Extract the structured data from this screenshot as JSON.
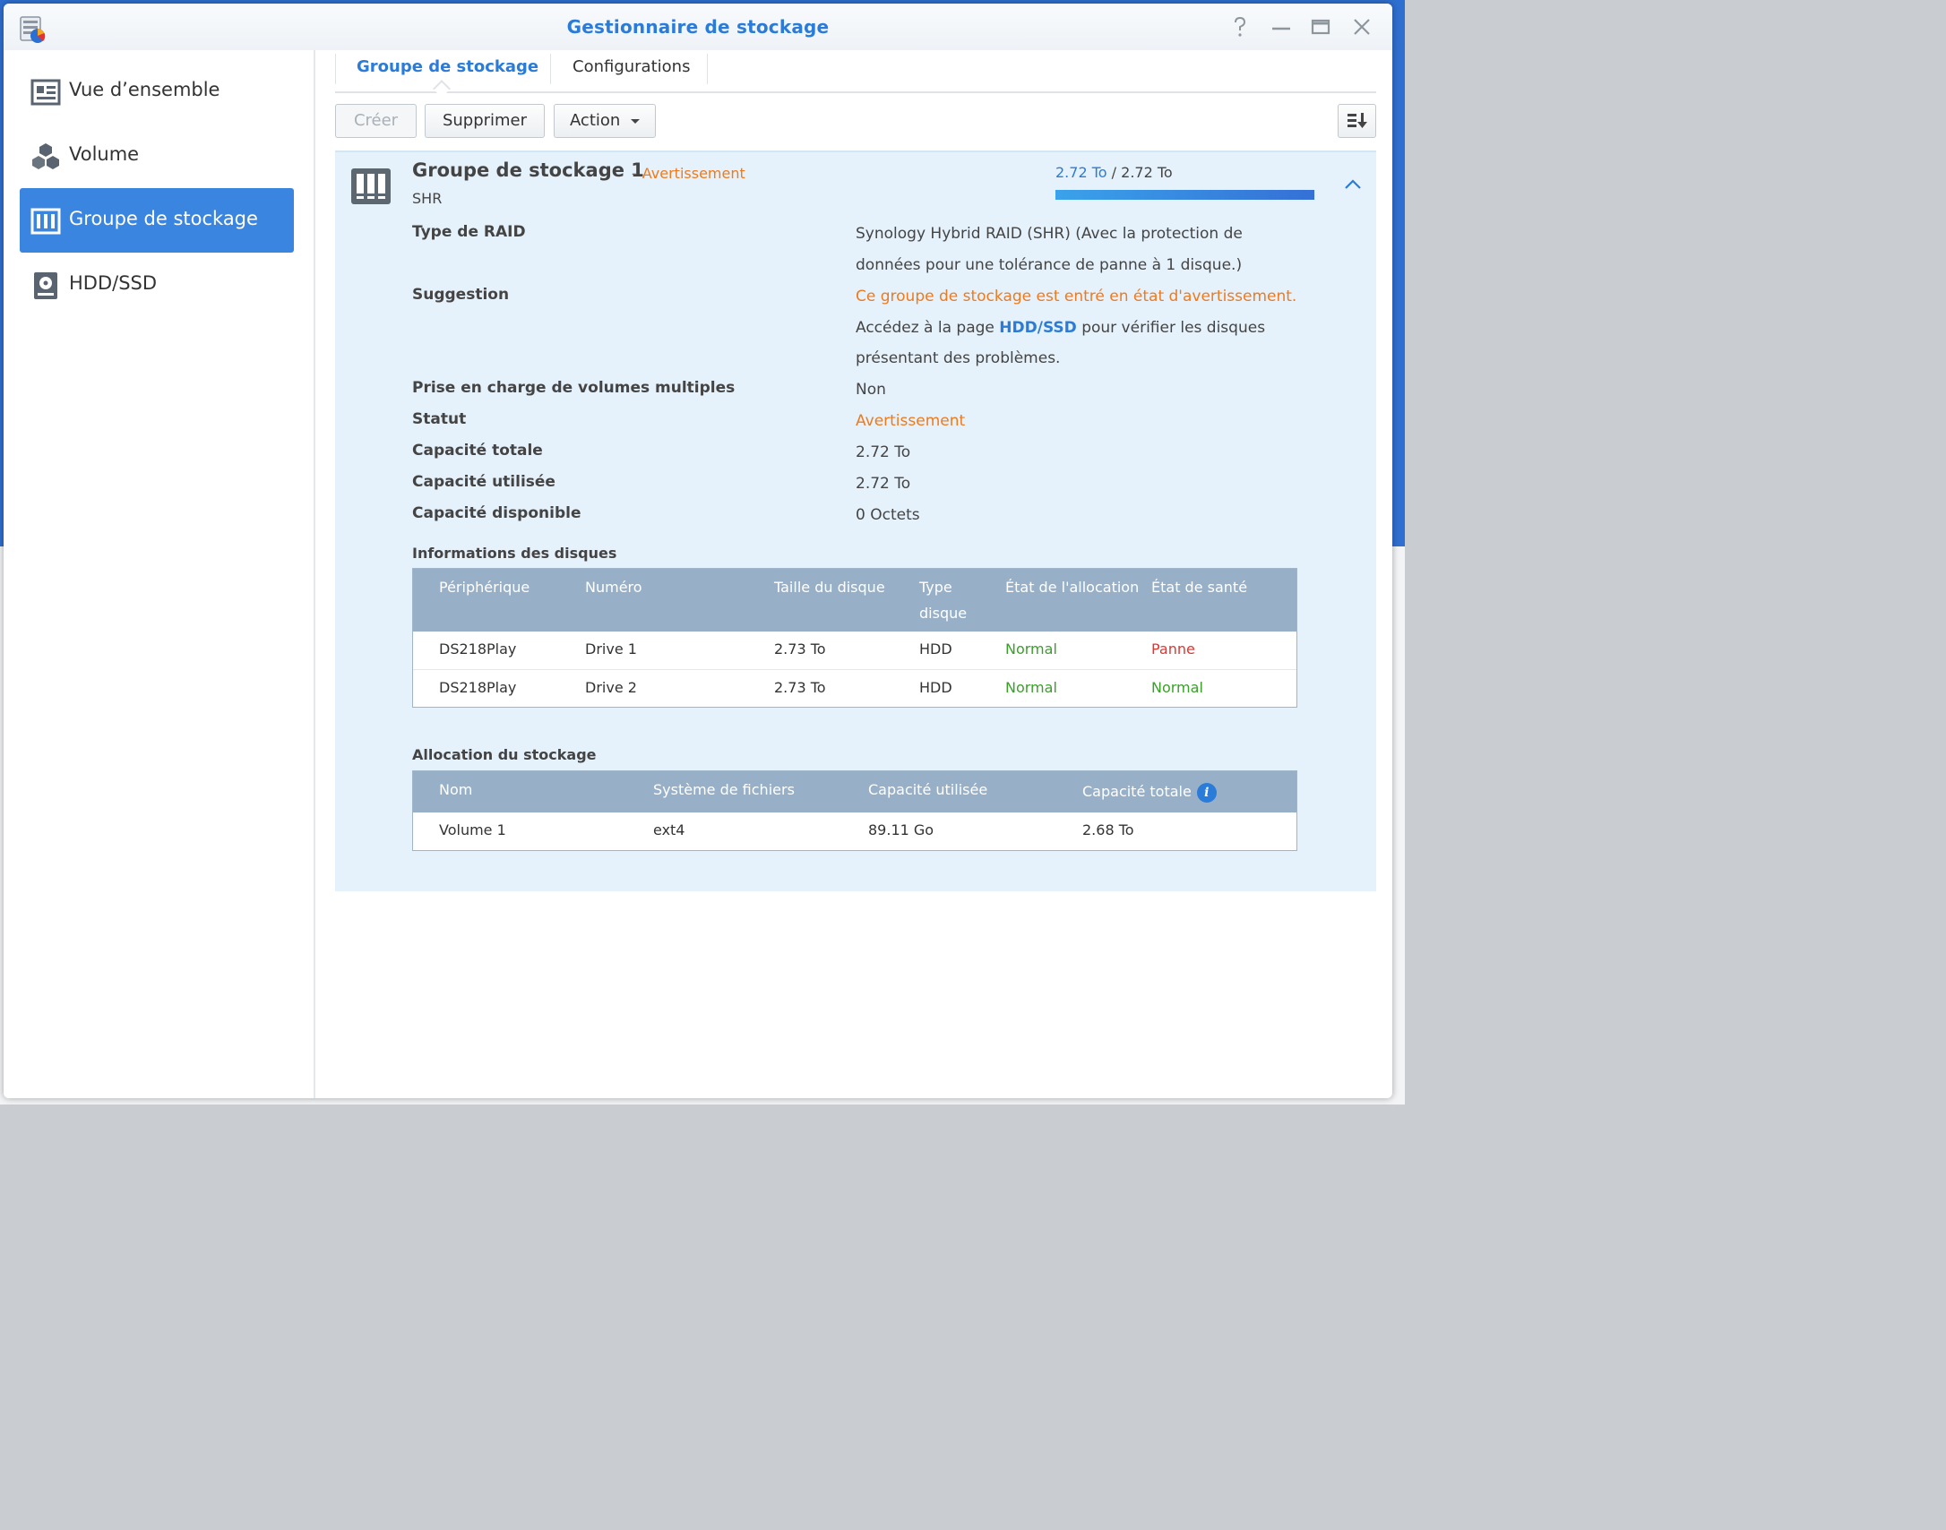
{
  "window": {
    "title": "Gestionnaire de stockage",
    "controls": [
      "help-icon",
      "minimize-icon",
      "maximize-icon",
      "close-icon"
    ]
  },
  "sidebar": {
    "items": [
      {
        "label": "Vue d’ensemble",
        "icon": "overview-icon",
        "active": false
      },
      {
        "label": "Volume",
        "icon": "cubes-icon",
        "active": false
      },
      {
        "label": "Groupe de stockage",
        "icon": "storage-pool-icon",
        "active": true
      },
      {
        "label": "HDD/SSD",
        "icon": "hdd-icon",
        "active": false
      }
    ]
  },
  "tabs": [
    {
      "label": "Groupe de stockage",
      "active": true
    },
    {
      "label": "Configurations",
      "active": false
    }
  ],
  "toolbar": {
    "create_label": "Créer",
    "delete_label": "Supprimer",
    "action_label": "Action",
    "sort_icon": "sort-down-icon"
  },
  "pool": {
    "title": "Groupe de stockage 1",
    "separator": "-",
    "status": "Avertissement",
    "type": "SHR",
    "usage_used": "2.72 To",
    "usage_sep": "/",
    "usage_total": "2.72 To",
    "usage_fraction": 1.0,
    "props": {
      "raid_label": "Type de RAID",
      "raid_value": "Synology Hybrid RAID (SHR) (Avec la protection de données pour une tolérance de panne à 1 disque.)",
      "suggestion_label": "Suggestion",
      "suggestion_warning": "Ce groupe de stockage est entré en état d'avertissement.",
      "suggestion_text1": " Accédez à la page ",
      "suggestion_link": "HDD/SSD",
      "suggestion_text2": " pour vérifier les disques présentant des problèmes.",
      "multi_label": "Prise en charge de volumes multiples",
      "multi_value": "Non",
      "status_label": "Statut",
      "status_value": "Avertissement",
      "total_label": "Capacité totale",
      "total_value": "2.72 To",
      "used_label": "Capacité utilisée",
      "used_value": "2.72 To",
      "free_label": "Capacité disponible",
      "free_value": "0 Octets"
    }
  },
  "disks": {
    "heading": "Informations des disques",
    "headers": {
      "device": "Périphérique",
      "number": "Numéro",
      "size": "Taille du disque",
      "type1": "Type",
      "type2": "disque",
      "alloc": "État de l'allocation",
      "health": "État de santé"
    },
    "rows": [
      {
        "device": "DS218Play",
        "number": "Drive 1",
        "size": "2.73 To",
        "type": "HDD",
        "alloc": "Normal",
        "health": "Panne"
      },
      {
        "device": "DS218Play",
        "number": "Drive 2",
        "size": "2.73 To",
        "type": "HDD",
        "alloc": "Normal",
        "health": "Normal"
      }
    ]
  },
  "allocation": {
    "heading": "Allocation du stockage",
    "headers": {
      "name": "Nom",
      "fs": "Système de fichiers",
      "used": "Capacité utilisée",
      "total": "Capacité totale"
    },
    "rows": [
      {
        "name": "Volume 1",
        "fs": "ext4",
        "used": "89.11 Go",
        "total": "2.68 To"
      }
    ]
  },
  "colors": {
    "accent": "#2b7bd8",
    "warning": "#ee7a1e",
    "ok": "#3aa02a",
    "error": "#e8322d",
    "table_header": "#97b0c8",
    "panel_bg": "#e6f2fb"
  }
}
